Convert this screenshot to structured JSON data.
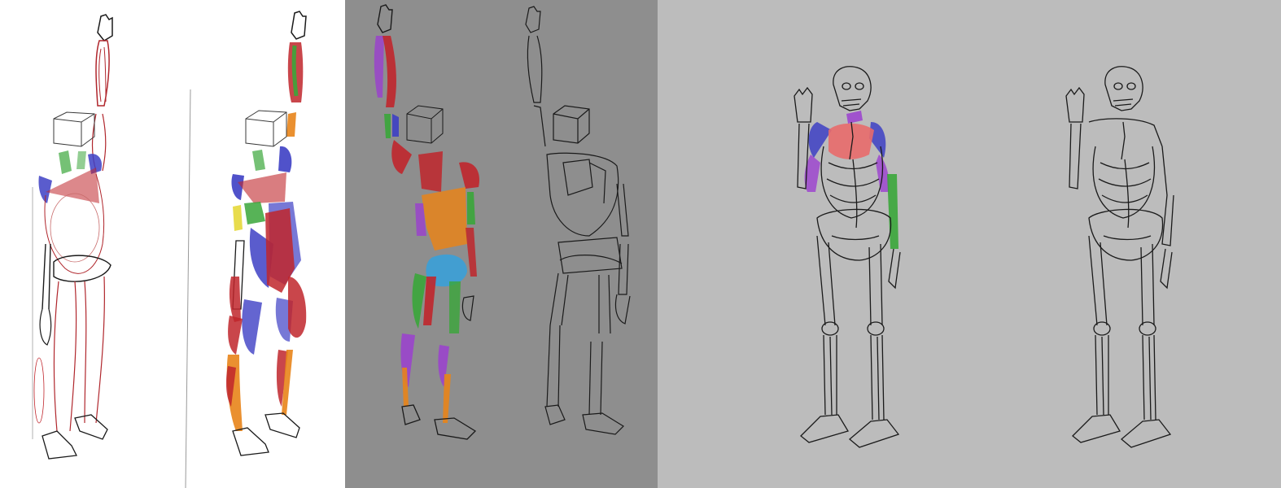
{
  "canvas": {
    "panels": [
      {
        "name": "white-sheet",
        "background": "#ffffff"
      },
      {
        "name": "mid-gray-sheet",
        "background": "#8e8e8e"
      },
      {
        "name": "light-gray-sheet",
        "background": "#bcbcbc"
      }
    ]
  },
  "palette": {
    "ink": "#1a1a1a",
    "red": "#c0262c",
    "blue": "#3d3fc4",
    "green": "#3aa63a",
    "orange": "#e8841a",
    "purple": "#9b3fd0",
    "cyan": "#3aa0d8",
    "yellow": "#e6d83a",
    "salmon": "#e86a6a",
    "skin": "#f2d8d8"
  }
}
